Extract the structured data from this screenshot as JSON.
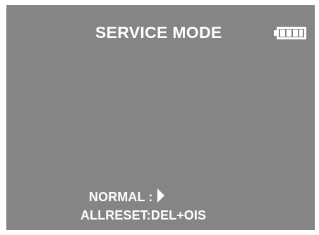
{
  "screen": {
    "title": "SERVICE MODE",
    "battery_icon": "battery-full-icon",
    "menu": {
      "normal_label": "NORMAL :",
      "normal_arrow_icon": "arrow-right-icon",
      "allreset_label": "ALLRESET:DEL+OIS"
    }
  },
  "colors": {
    "background": "#858585",
    "text": "#ffffff"
  }
}
